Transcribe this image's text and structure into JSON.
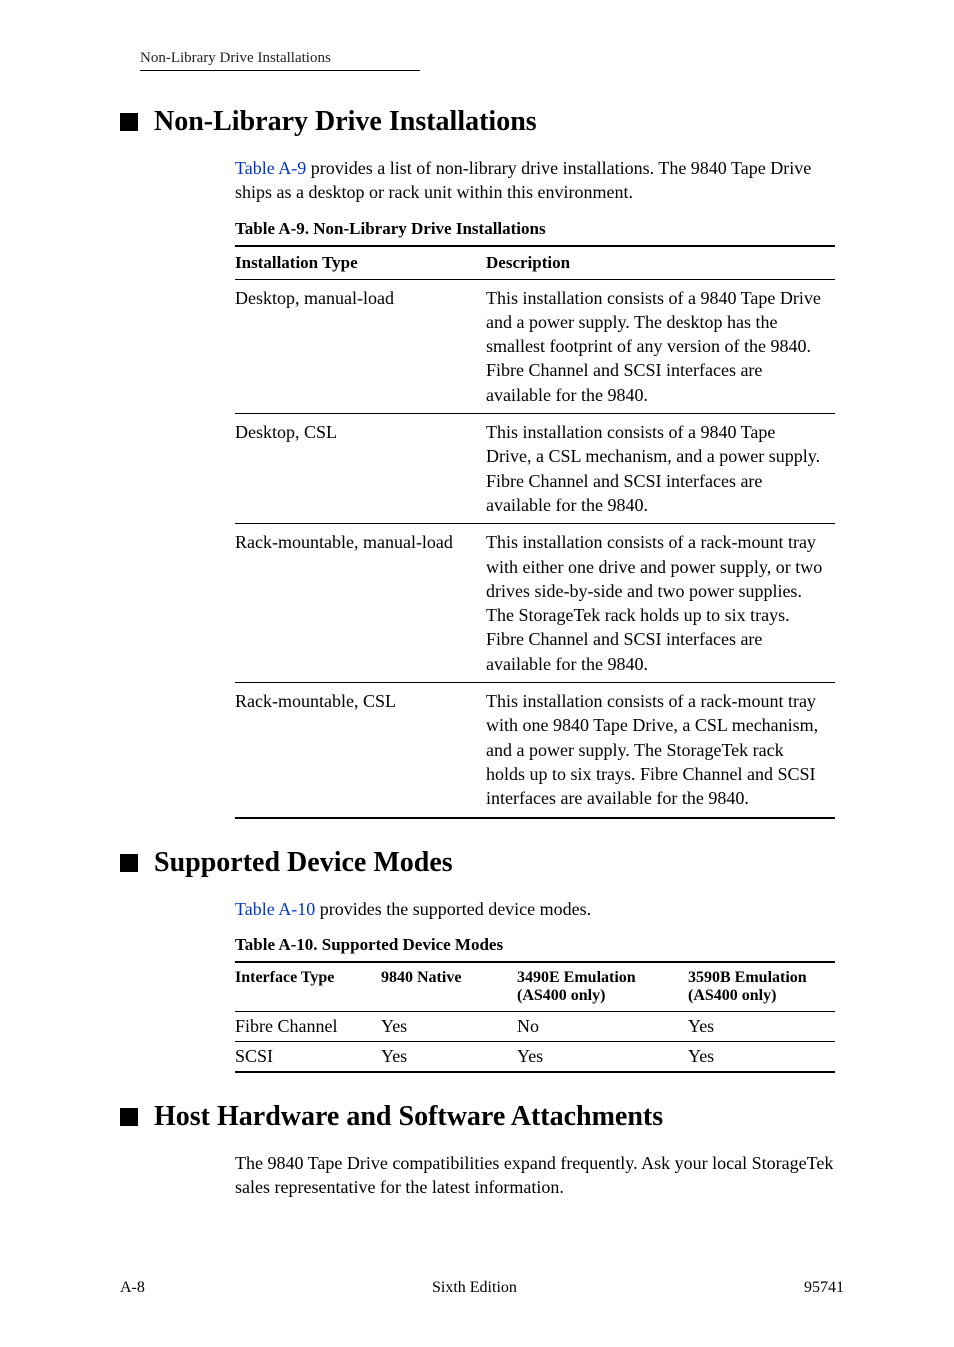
{
  "header": {
    "running": "Non-Library Drive Installations"
  },
  "section1": {
    "title": "Non-Library Drive Installations",
    "intro_link": "Table A-9",
    "intro_rest": " provides a list of non-library drive installations. The 9840 Tape Drive ships as a desktop or rack unit within this environment.",
    "table_caption": "Table A-9. Non-Library Drive Installations",
    "col1": "Installation Type",
    "col2": "Description",
    "rows": [
      {
        "type": "Desktop, manual-load",
        "desc": "This installation consists of a 9840 Tape Drive and a power supply. The desktop has the smallest footprint of any version of the 9840. Fibre Channel and SCSI interfaces are available for the 9840."
      },
      {
        "type": "Desktop, CSL",
        "desc": "This installation consists of a 9840 Tape Drive, a CSL mechanism, and a power supply. Fibre Channel and SCSI interfaces are available for the 9840."
      },
      {
        "type": "Rack-mountable, manual-load",
        "desc": "This installation consists of a rack-mount tray with either one drive and power supply, or two drives side-by-side and two power supplies. The StorageTek rack holds up to six trays. Fibre Channel and SCSI interfaces are available for the 9840."
      },
      {
        "type": "Rack-mountable, CSL",
        "desc": "This installation consists of a rack-mount tray with one 9840 Tape Drive, a CSL mechanism, and a power supply. The StorageTek rack holds up to six trays. Fibre Channel and SCSI interfaces are available for the 9840."
      }
    ]
  },
  "section2": {
    "title": "Supported Device Modes",
    "intro_link": "Table A-10",
    "intro_rest": " provides the supported device modes.",
    "table_caption": "Table A-10. Supported Device Modes",
    "col1": "Interface Type",
    "col2": "9840 Native",
    "col3": "3490E Emulation (AS400 only)",
    "col4": "3590B Emulation (AS400 only)",
    "rows": [
      {
        "c1": "Fibre Channel",
        "c2": "Yes",
        "c3": "No",
        "c4": "Yes"
      },
      {
        "c1": "SCSI",
        "c2": "Yes",
        "c3": "Yes",
        "c4": "Yes"
      }
    ]
  },
  "section3": {
    "title": "Host Hardware and Software Attachments",
    "body": "The 9840 Tape Drive compatibilities expand frequently. Ask your local StorageTek sales representative for the latest information."
  },
  "footer": {
    "left": "A-8",
    "center": "Sixth Edition",
    "right": "95741"
  }
}
